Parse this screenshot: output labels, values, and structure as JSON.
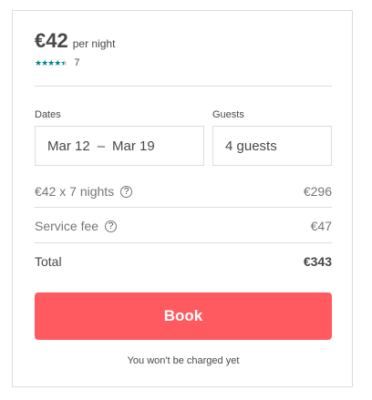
{
  "listing": {
    "price": "€42",
    "per_night": "per night",
    "rating": 4.5,
    "review_count": "7"
  },
  "booking": {
    "dates_label": "Dates",
    "guests_label": "Guests",
    "check_in": "Mar 12",
    "arrow": "–",
    "check_out": "Mar 19",
    "guests_value": "4 guests"
  },
  "breakdown": {
    "nights_label": "€42 x 7 nights",
    "nights_amount": "€296",
    "service_fee_label": "Service fee",
    "service_fee_amount": "€47",
    "total_label": "Total",
    "total_amount": "€343",
    "help_glyph": "?"
  },
  "actions": {
    "book_label": "Book",
    "note": "You won't be charged yet"
  },
  "colors": {
    "accent": "#ff5a5f",
    "stars": "#008489"
  }
}
